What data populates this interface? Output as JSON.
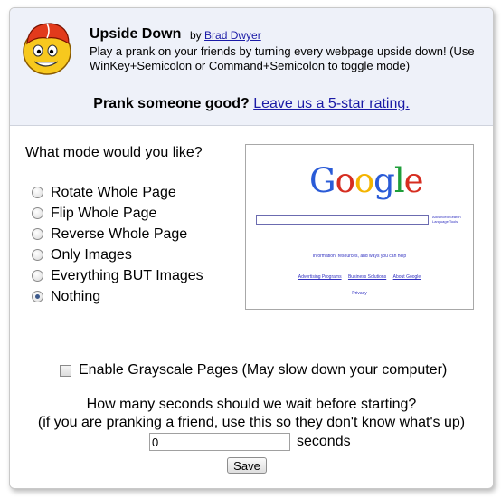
{
  "header": {
    "title": "Upside Down",
    "by_prefix": "by",
    "author": "Brad Dwyer",
    "description": "Play a prank on your friends by turning every webpage upside down! (Use WinKey+Semicolon or Command+Semicolon to toggle mode)",
    "prank_prompt": "Prank someone good?",
    "rating_link": "Leave us a 5-star rating."
  },
  "mode": {
    "question": "What mode would you like?",
    "options": [
      {
        "label": "Rotate Whole Page",
        "checked": false
      },
      {
        "label": "Flip Whole Page",
        "checked": false
      },
      {
        "label": "Reverse Whole Page",
        "checked": false
      },
      {
        "label": "Only Images",
        "checked": false
      },
      {
        "label": "Everything BUT Images",
        "checked": false
      },
      {
        "label": "Nothing",
        "checked": true
      }
    ]
  },
  "preview": {
    "logo_letters": [
      "G",
      "o",
      "o",
      "g",
      "l",
      "e"
    ],
    "logo_colors": [
      "#2a5bd7",
      "#d62d20",
      "#f4b400",
      "#2a5bd7",
      "#1f9e3a",
      "#d62d20"
    ],
    "side_links": [
      "Advanced Search",
      "Language Tools"
    ],
    "info_line": "Information, resources, and ways you can help",
    "links": [
      "Advertising Programs",
      "Business Solutions",
      "About Google"
    ],
    "footer_link": "Privacy"
  },
  "grayscale": {
    "label": "Enable Grayscale Pages (May slow down your computer)",
    "checked": false
  },
  "wait": {
    "question": "How many seconds should we wait before starting?",
    "subtext": "(if you are pranking a friend, use this so they don't know what's up)",
    "value": "0",
    "unit": "seconds"
  },
  "save_label": "Save"
}
